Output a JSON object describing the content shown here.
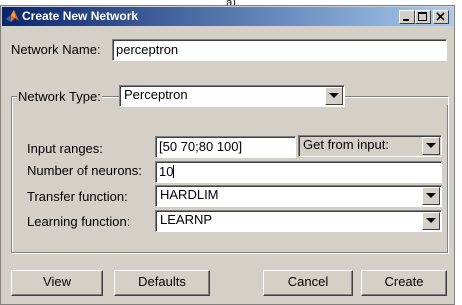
{
  "caption": "a)",
  "window": {
    "title": "Create New Network"
  },
  "network_name": {
    "label": "Network Name:",
    "value": "perceptron"
  },
  "network_type": {
    "label": "Network Type:",
    "selected": "Perceptron"
  },
  "input_ranges": {
    "label": "Input ranges:",
    "value": "[50 70;80 100]",
    "source_selected": "Get from input:"
  },
  "num_neurons": {
    "label": "Number of neurons:",
    "value": "10"
  },
  "transfer_function": {
    "label": "Transfer function:",
    "selected": "HARDLIM"
  },
  "learning_function": {
    "label": "Learning function:",
    "selected": "LEARNP"
  },
  "buttons": {
    "view": "View",
    "defaults": "Defaults",
    "cancel": "Cancel",
    "create": "Create"
  }
}
